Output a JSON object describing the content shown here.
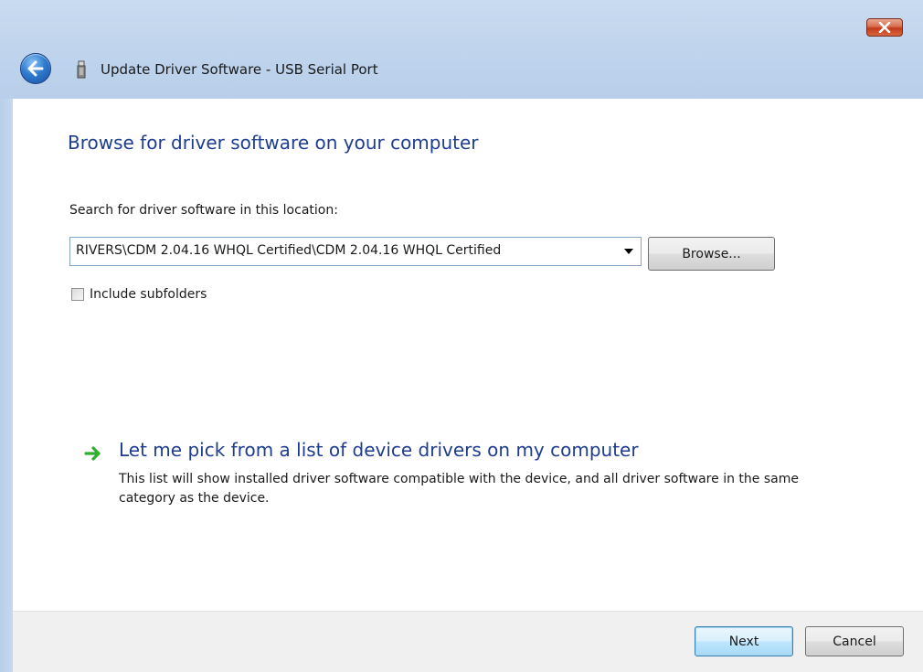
{
  "window": {
    "title": "Update Driver Software - USB Serial Port",
    "close_icon": "close-icon",
    "back_icon": "back-arrow-icon",
    "device_icon": "usb-device-icon"
  },
  "main": {
    "heading": "Browse for driver software on your computer",
    "location_label": "Search for driver software in this location:",
    "location_value": "RIVERS\\CDM 2.04.16 WHQL Certified\\CDM 2.04.16 WHQL Certified",
    "browse_label": "Browse...",
    "include_subfolders_label": "Include subfolders",
    "include_subfolders_checked": false,
    "pick_link_title": "Let me pick from a list of device drivers on my computer",
    "pick_link_description": "This list will show installed driver software compatible with the device, and all driver software in the same category as the device."
  },
  "footer": {
    "next_label": "Next",
    "cancel_label": "Cancel"
  },
  "colors": {
    "heading": "#1e3d8f",
    "link_arrow": "#2fae2f",
    "close_button": "#c1391a",
    "frame": "#bed3ec"
  }
}
